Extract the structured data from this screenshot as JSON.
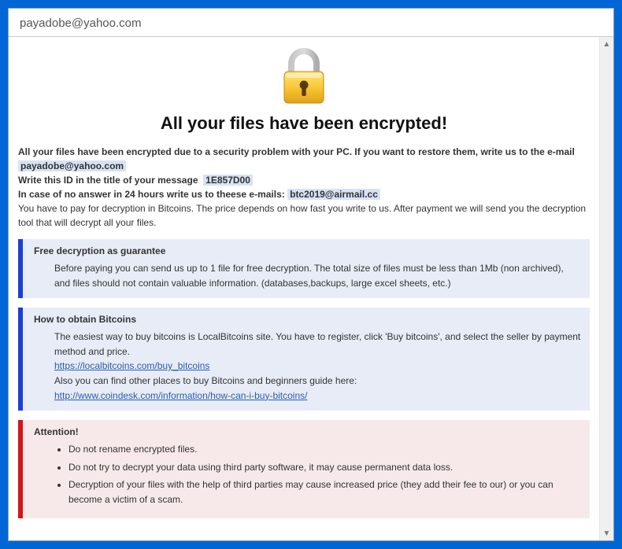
{
  "window": {
    "title": "payadobe@yahoo.com"
  },
  "main": {
    "heading": "All your files have been encrypted!",
    "line1_prefix": "All your files have been encrypted due to a security problem with your PC. If you want to restore them, write us to the e-mail",
    "email_primary": "payadobe@yahoo.com",
    "line2_prefix": "Write this ID in the title of your message",
    "id_value": "1E857D00",
    "line3_prefix": "In case of no answer in 24 hours write us to theese e-mails:",
    "email_secondary": "btc2019@airmail.cc",
    "payline": "You have to pay for decryption in Bitcoins. The price depends on how fast you write to us. After payment we will send you the decryption tool that will decrypt all your files."
  },
  "panel_guarantee": {
    "title": "Free decryption as guarantee",
    "body": "Before paying you can send us up to 1 file for free decryption. The total size of files must be less than 1Mb (non archived), and files should not contain valuable information. (databases,backups, large excel sheets, etc.)"
  },
  "panel_bitcoins": {
    "title": "How to obtain Bitcoins",
    "body1": "The easiest way to buy bitcoins is LocalBitcoins site. You have to register, click 'Buy bitcoins', and select the seller by payment method and price.",
    "link1": "https://localbitcoins.com/buy_bitcoins",
    "body2": "Also you can find other places to buy Bitcoins and beginners guide here:",
    "link2": "http://www.coindesk.com/information/how-can-i-buy-bitcoins/"
  },
  "panel_attention": {
    "title": "Attention!",
    "items": [
      "Do not rename encrypted files.",
      "Do not try to decrypt your data using third party software, it may cause permanent data loss.",
      "Decryption of your files with the help of third parties may cause increased price (they add their fee to our) or you can become a victim of a scam."
    ]
  },
  "icons": {
    "lock": "lock-icon",
    "scroll_up": "▲",
    "scroll_down": "▼"
  }
}
